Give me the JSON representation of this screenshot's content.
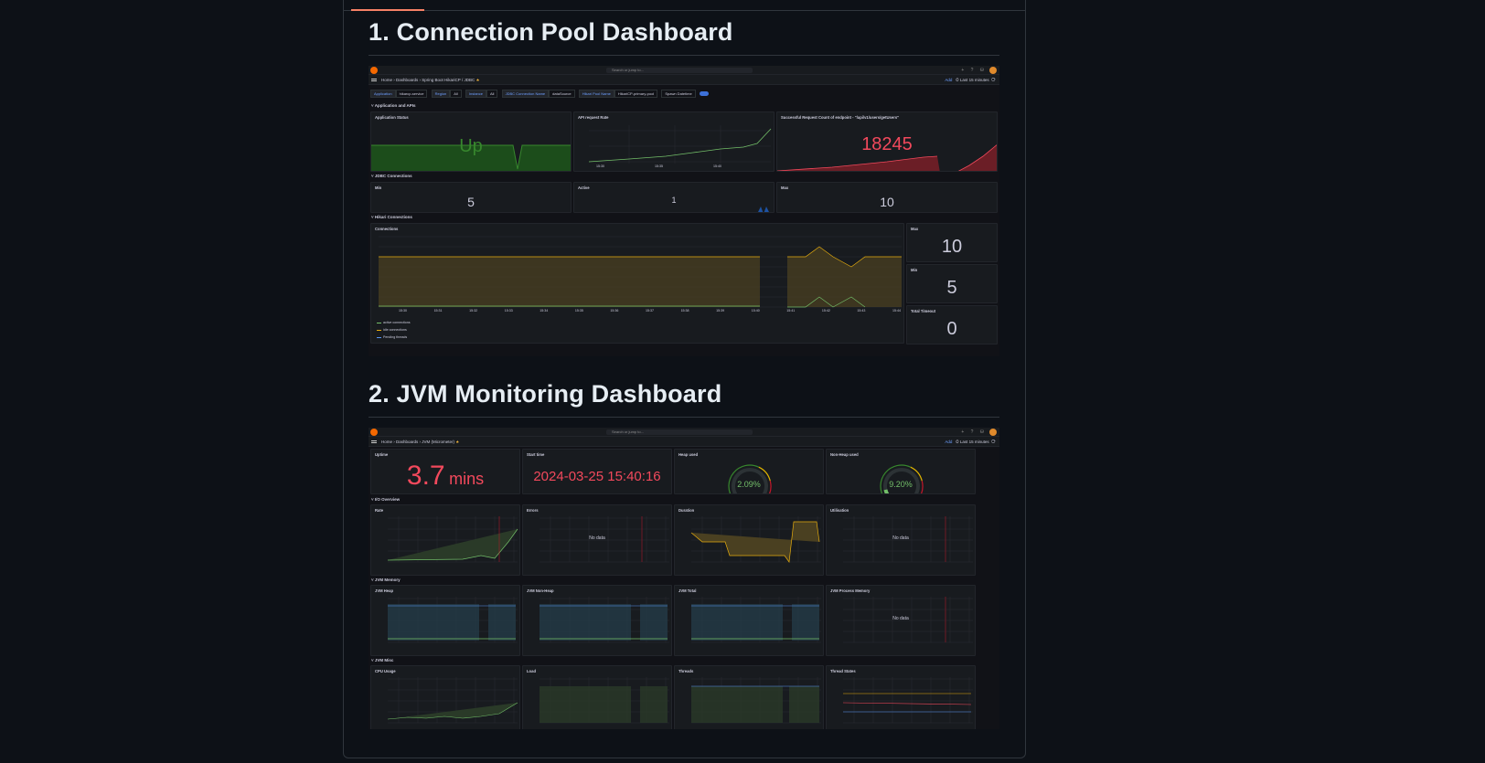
{
  "sections": [
    {
      "title": "1. Connection Pool Dashboard"
    },
    {
      "title": "2. JVM Monitoring Dashboard"
    }
  ],
  "pool": {
    "search": "Search or jump to...",
    "crumbs": [
      "Home",
      "Dashboards",
      "Spring Boot HikariCP / JDBC"
    ],
    "add": "Add",
    "time": "Last 15 minutes",
    "vars": [
      {
        "label": "Application",
        "value": "hikarcp-service"
      },
      {
        "label": "Region",
        "value": "All"
      },
      {
        "label": "Instance",
        "value": "All"
      },
      {
        "label": "JDBC Connection Name",
        "value": "dataSource"
      },
      {
        "label": "Hikari Pool Name",
        "value": "HikariCP-primary-pool"
      },
      {
        "label": "Spawn Datetime",
        "value": ""
      }
    ],
    "rows": [
      "Application and APIs",
      "JDBC Connections",
      "Hikari Connections"
    ],
    "app_status": {
      "title": "Application Status",
      "value": "Up",
      "color": "#37872d"
    },
    "api_rate": {
      "title": "API request Rate",
      "ticks": [
        "15:30",
        "15:35",
        "15:40"
      ]
    },
    "success_count": {
      "title": "Successful Request Count of endpoint - \"/api/v1/users/getUsers\"",
      "value": "18245",
      "color": "#f2495c"
    },
    "jdbc_min": {
      "title": "Min",
      "value": "5"
    },
    "jdbc_active": {
      "title": "Active",
      "value": "1"
    },
    "jdbc_max": {
      "title": "Max",
      "value": "10"
    },
    "connections": {
      "title": "Connections",
      "ticks": [
        "15:30",
        "15:31",
        "15:32",
        "15:33",
        "15:34",
        "15:35",
        "15:36",
        "15:37",
        "15:38",
        "15:39",
        "15:40",
        "15:41",
        "15:42",
        "15:43",
        "15:44"
      ],
      "legend": [
        "active connections",
        "idle connections",
        "Pending threads"
      ]
    },
    "hikari_max": {
      "title": "Max",
      "value": "10"
    },
    "hikari_min": {
      "title": "Min",
      "value": "5"
    },
    "hikari_timeout": {
      "title": "Total Timeout",
      "value": "0"
    }
  },
  "jvm": {
    "search": "Search or jump to...",
    "crumbs": [
      "Home",
      "Dashboards",
      "JVM (Micrometer)"
    ],
    "add": "Add",
    "time": "Last 15 minutes",
    "uptime": {
      "title": "Uptime",
      "value": "3.7",
      "unit": "mins",
      "color": "#f2495c"
    },
    "start_time": {
      "title": "Start time",
      "value": "2024-03-25 15:40:16",
      "color": "#f2495c"
    },
    "heap_used": {
      "title": "Heap used",
      "value": "2.09%",
      "fraction": 0.0209
    },
    "nonheap_used": {
      "title": "Non-Heap used",
      "value": "9.20%",
      "fraction": 0.092
    },
    "rows": [
      "I/O Overview",
      "JVM Memory",
      "JVM Misc"
    ],
    "io": [
      {
        "title": "Rate",
        "nodata": ""
      },
      {
        "title": "Errors",
        "nodata": "No data"
      },
      {
        "title": "Duration",
        "nodata": ""
      },
      {
        "title": "Utilisation",
        "nodata": "No data"
      }
    ],
    "mem": [
      {
        "title": "JVM Heap",
        "nodata": ""
      },
      {
        "title": "JVM Non-Heap",
        "nodata": ""
      },
      {
        "title": "JVM Total",
        "nodata": ""
      },
      {
        "title": "JVM Process Memory",
        "nodata": "No data"
      }
    ],
    "misc": [
      {
        "title": "CPU Usage"
      },
      {
        "title": "Load"
      },
      {
        "title": "Threads"
      },
      {
        "title": "Thread States"
      }
    ]
  }
}
